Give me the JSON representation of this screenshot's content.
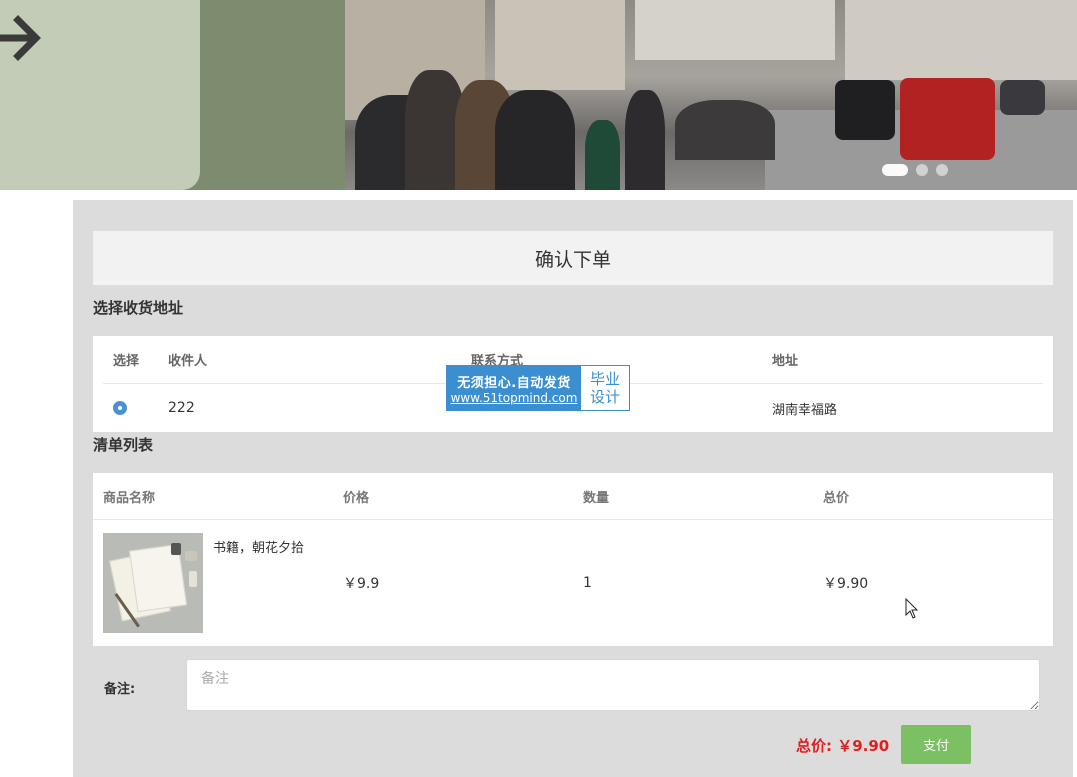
{
  "banner": {
    "arrow_icon": "arrow-right-icon",
    "carousel_dots": 3,
    "active_dot": 0
  },
  "order": {
    "title": "确认下单",
    "address_section": {
      "title": "选择收货地址",
      "columns": [
        "选择",
        "收件人",
        "联系方式",
        "地址"
      ],
      "rows": [
        {
          "selected": true,
          "recipient": "222",
          "contact": "",
          "address": "湖南幸福路"
        }
      ]
    },
    "goods_section": {
      "title": "清单列表",
      "columns": [
        "商品名称",
        "价格",
        "数量",
        "总价"
      ],
      "rows": [
        {
          "name": "书籍，朝花夕拾",
          "price": "￥9.9",
          "quantity": "1",
          "total": "￥9.90"
        }
      ]
    },
    "remark": {
      "label": "备注:",
      "placeholder": "备注",
      "value": ""
    },
    "total_label": "总价: ￥9.90",
    "pay_button": "支付"
  },
  "watermark": {
    "line1": "无须担心.自动发货",
    "line2": "www.51topmind.com",
    "right_top": "毕业",
    "right_bottom": "设计"
  },
  "colors": {
    "panel_bg": "#dcdcdc",
    "accent_green": "#7cc064",
    "total_red": "#e02020",
    "radio_blue": "#4a8fd9",
    "watermark_blue": "#3b8fd0"
  }
}
